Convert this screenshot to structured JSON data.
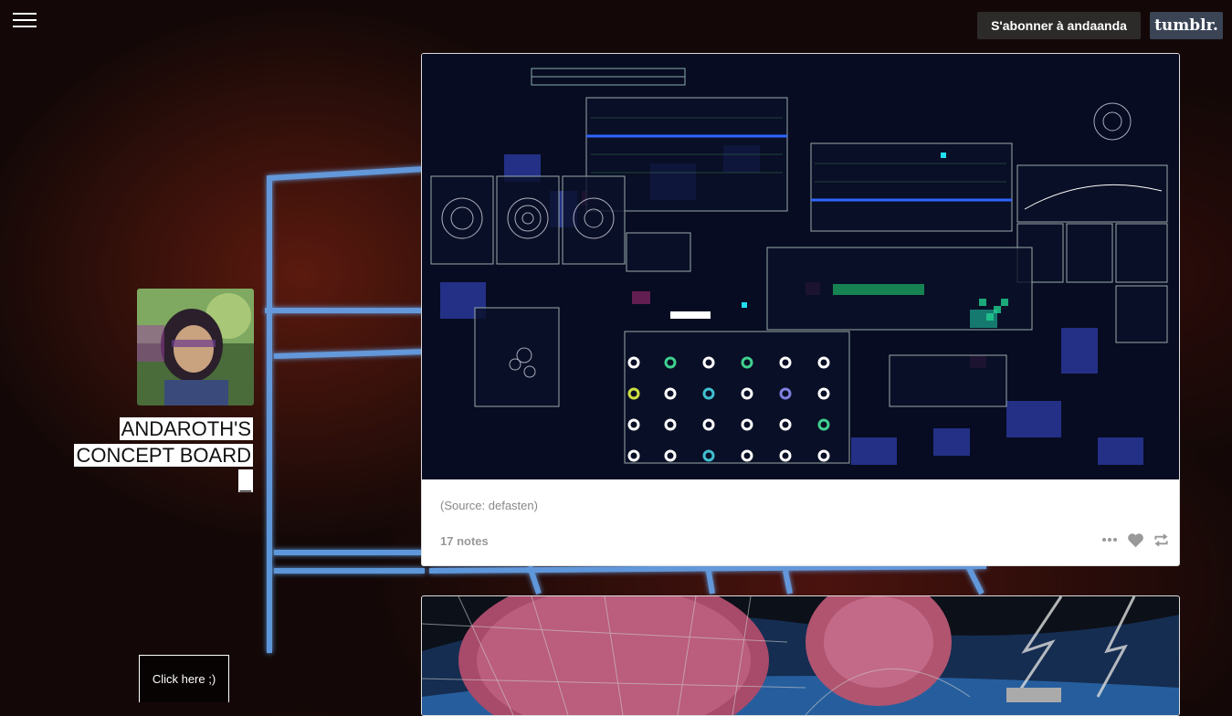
{
  "header": {
    "menu_icon": "hamburger-menu-icon",
    "follow_label": "S'abonner à andaanda",
    "logo_text": "tumblr."
  },
  "sidebar": {
    "avatar_icon": "blog-avatar",
    "title": "ANDAROTH'S CONCEPT BOARD _",
    "click_label": "Click here ;)"
  },
  "posts": [
    {
      "image": "sci-fi-hud-interface-image",
      "source_prefix": "(Source: ",
      "source_name": "defasten",
      "source_suffix": ")",
      "notes": "17 notes",
      "actions": [
        "more-dots-icon",
        "like-heart-icon",
        "reblog-icon"
      ]
    },
    {
      "image": "space-station-pink-spheres-image"
    }
  ],
  "colors": {
    "accent_blue": "#2e7cff",
    "tumblr_bg": "#3a4454",
    "neon": "#5aa8ff"
  }
}
